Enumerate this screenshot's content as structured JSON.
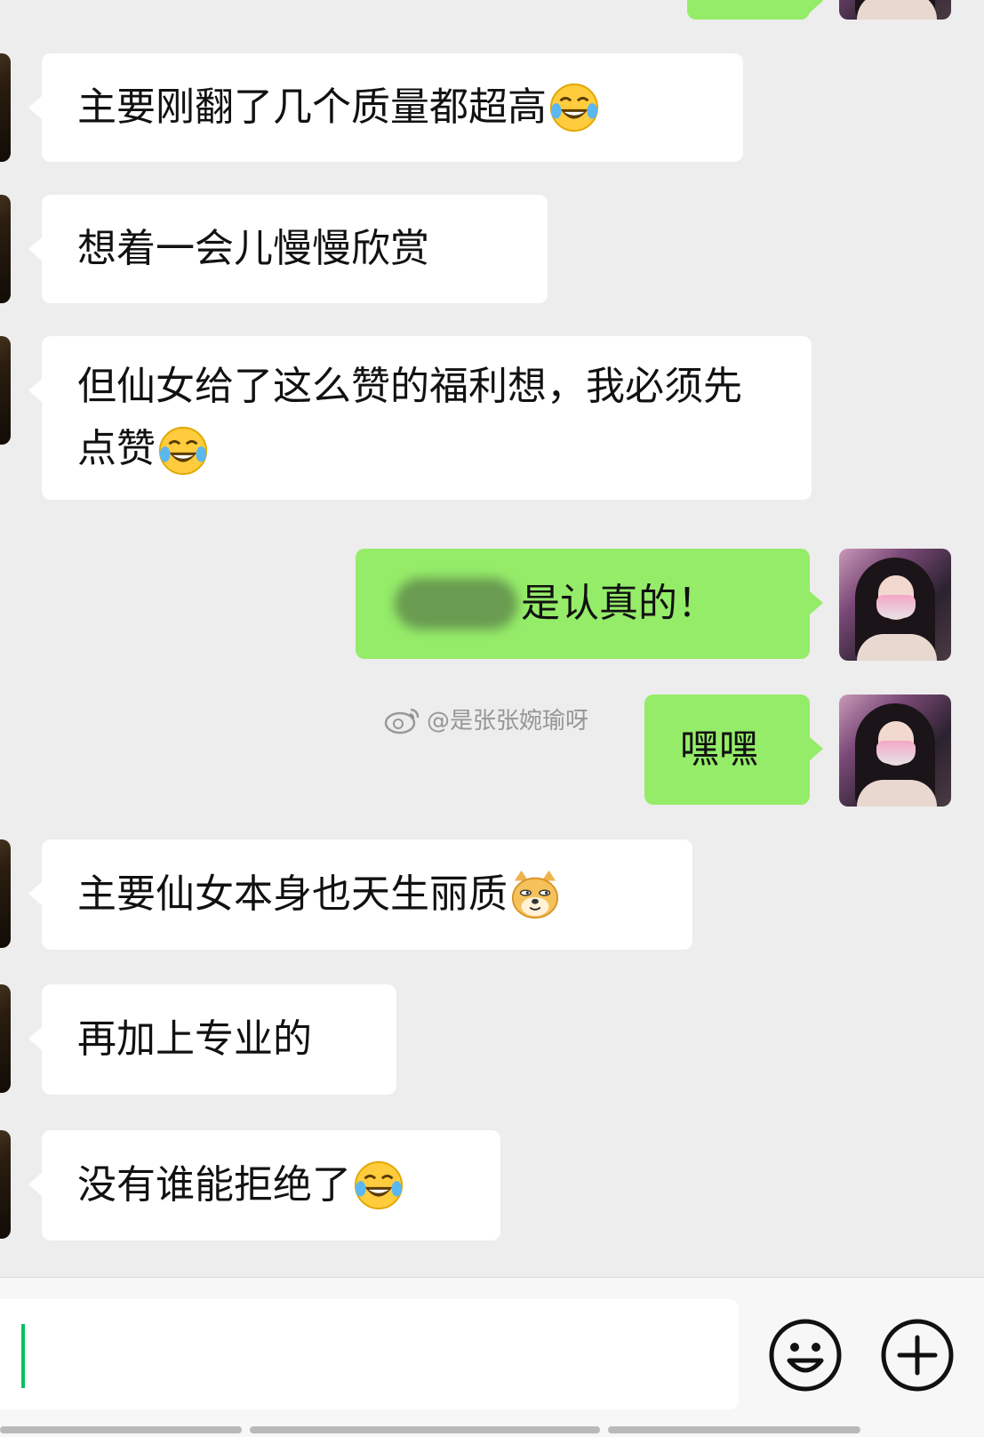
{
  "messages": [
    {
      "direction": "in",
      "text": "主要刚翻了几个质量都超高",
      "emoji": "laugh-cry-emoji"
    },
    {
      "direction": "in",
      "text": "想着一会儿慢慢欣赏"
    },
    {
      "direction": "in",
      "text": "但仙女给了这么赞的福利想，我必须先点赞",
      "emoji": "laugh-cry-emoji"
    },
    {
      "direction": "out",
      "text": "是认真的！",
      "blurred_prefix": true
    },
    {
      "direction": "out",
      "text": "嘿嘿"
    },
    {
      "direction": "in",
      "text": "主要仙女本身也天生丽质",
      "emoji": "doge-emoji"
    },
    {
      "direction": "in",
      "text": "再加上专业的"
    },
    {
      "direction": "in",
      "text": "没有谁能拒绝了",
      "emoji": "laugh-cry-emoji"
    }
  ],
  "watermark": {
    "text": "@是张张婉瑜呀",
    "icon": "weibo-icon"
  },
  "input_bar": {
    "value": "",
    "emoji_button_icon": "smiley-icon",
    "more_button_icon": "plus-icon"
  },
  "colors": {
    "background": "#ededed",
    "incoming_bubble": "#ffffff",
    "outgoing_bubble": "#95ec69",
    "caret": "#07c160"
  }
}
